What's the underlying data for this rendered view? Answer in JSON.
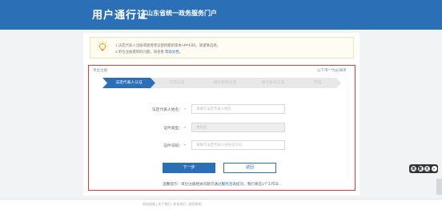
{
  "header": {
    "title": "用户通行证",
    "subtitle": "山东省统一政务服务门户"
  },
  "notice": {
    "line1": "1.法定代表人注册或使用建议使用最新版本APP扫码，请谨慎选择。",
    "line2_prefix": "2.单位注册遇到的问题，请查看",
    "line2_link": "帮助文档。"
  },
  "breadcrumb": "单位注册",
  "required_hint": "以下带\"*\"为必填项",
  "steps": [
    {
      "label": "法定代表人认证",
      "state": "active"
    },
    {
      "label": "实名认证",
      "state": "inactive"
    },
    {
      "label": "填写单位信息",
      "state": "inactive"
    },
    {
      "label": "填写账号信息",
      "state": "inactive"
    },
    {
      "label": "完成",
      "state": "inactive"
    }
  ],
  "form": {
    "name_label": "法定代表人姓名：",
    "name_placeholder": "请填写法定代表人姓名",
    "type_label": "证件类型：",
    "type_value": "身份证",
    "id_label": "证件号码：",
    "id_placeholder": "请填写法定代表人身份证号码",
    "required_mark": "*"
  },
  "buttons": {
    "next": "下一步",
    "back": "返回"
  },
  "tip": {
    "prefix": "温馨提示：单位注册相关问题可通过",
    "link": "服务咨询",
    "suffix": "提问，我们将在1个工作日..."
  },
  "float_toolbar": [
    "简",
    "繁",
    "无",
    "+"
  ],
  "footer": {
    "links": "网站地图  |  关于我们  |  联系我们  |  使用帮助"
  },
  "colors": {
    "primary": "#2b6fb6",
    "highlight_border": "#e03a3a"
  }
}
